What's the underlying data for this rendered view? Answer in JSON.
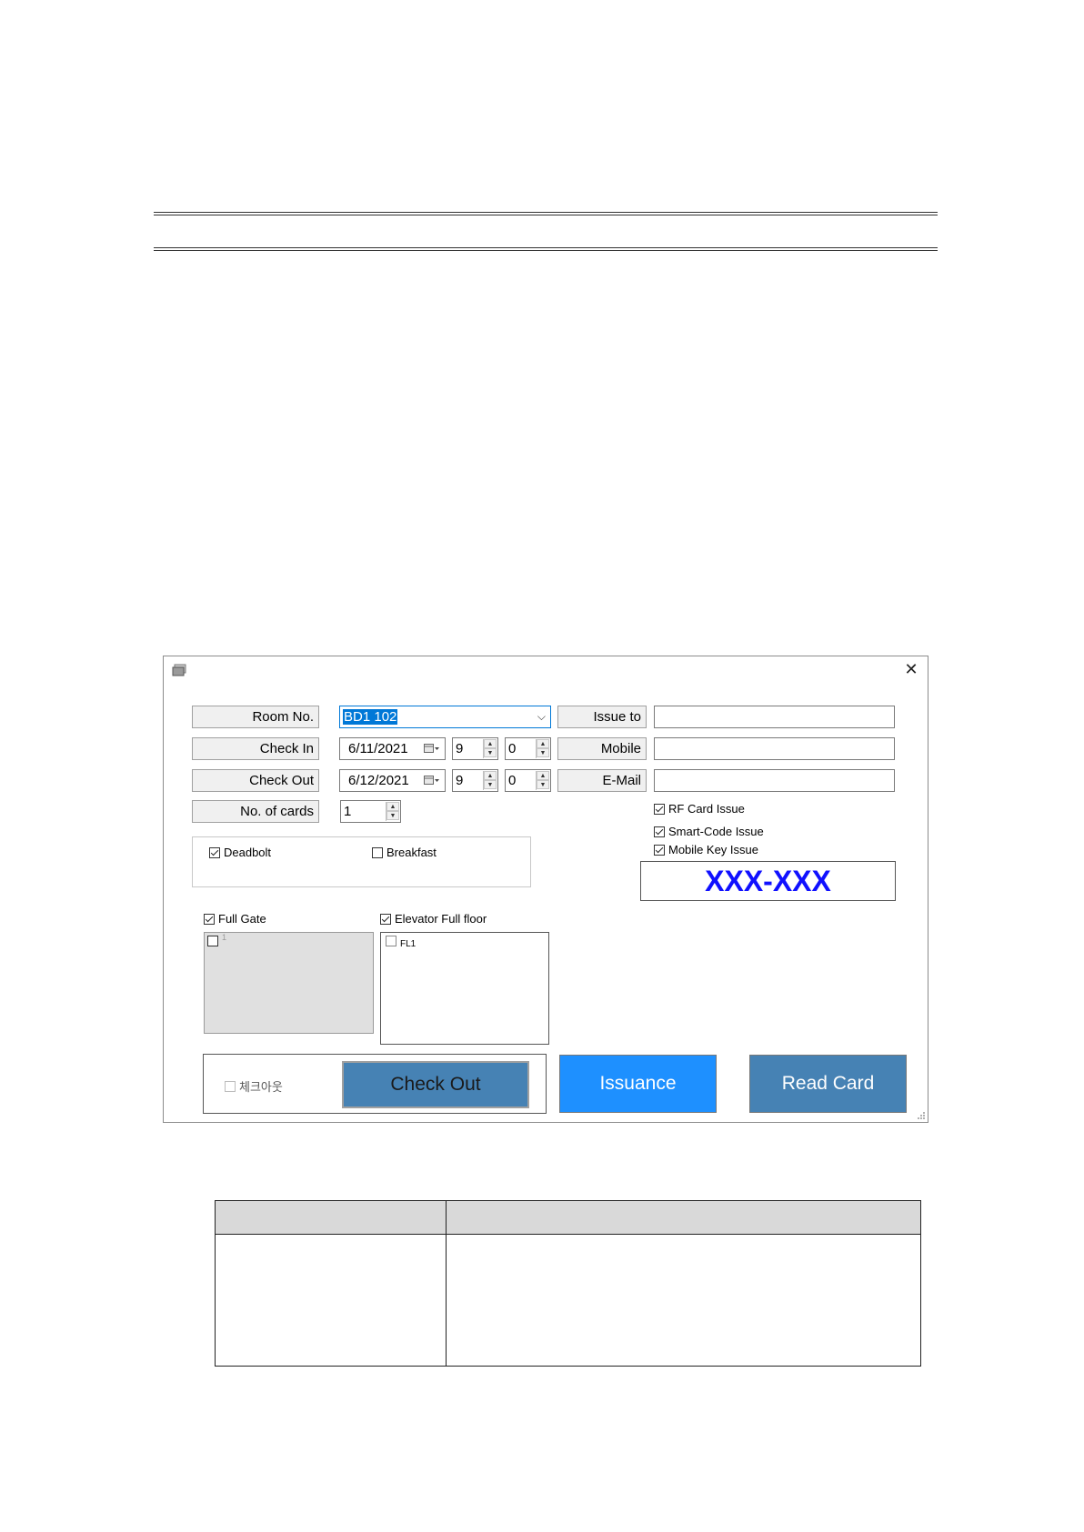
{
  "dialog": {
    "close_icon": "close-icon",
    "labels": {
      "room_no": "Room No.",
      "check_in": "Check In",
      "check_out": "Check Out",
      "no_of_cards": "No. of cards",
      "issue_to": "Issue to",
      "mobile": "Mobile",
      "email": "E-Mail"
    },
    "room_no_value": "BD1 102",
    "check_in": {
      "date": "6/11/2021",
      "hour": "9",
      "minute": "0"
    },
    "check_out": {
      "date": "6/12/2021",
      "hour": "9",
      "minute": "0"
    },
    "no_of_cards_value": "1",
    "issue_to_value": "",
    "mobile_value": "",
    "email_value": "",
    "options": {
      "rf_card_issue": "RF Card Issue",
      "smart_code_issue": "Smart-Code Issue",
      "mobile_key_issue": "Mobile Key Issue"
    },
    "code_display": "XXX-XXX",
    "extras": {
      "deadbolt": "Deadbolt",
      "breakfast": "Breakfast"
    },
    "full_gate": "Full Gate",
    "gate_item": "1",
    "elevator_full_floor": "Elevator Full floor",
    "floor_item": "FL1",
    "checkout_checkbox": "체크아웃",
    "buttons": {
      "check_out": "Check Out",
      "issuance": "Issuance",
      "read_card": "Read Card"
    },
    "colors": {
      "accent": "#0078d7",
      "steel_button": "#4682b4",
      "issuance_button": "#1e90ff",
      "code_text": "#1010ff"
    }
  }
}
